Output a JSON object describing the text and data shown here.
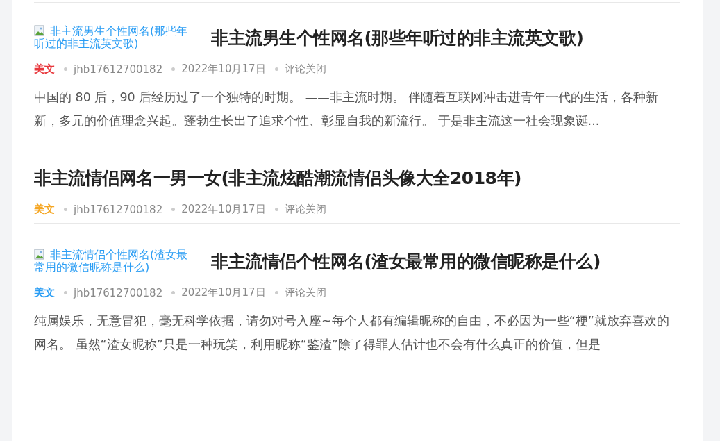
{
  "posts": [
    {
      "thumbnail": {
        "alt": "非主流男生个性网名(那些年听过的非主流英文歌)"
      },
      "title": "非主流男生个性网名(那些年听过的非主流英文歌)",
      "category": "美文",
      "color": "#e8383d",
      "author": "jhb17612700182",
      "date": "2022年10月17日",
      "comments": "评论关闭",
      "excerpt": "中国的 80 后，90 后经历过了一个独特的时期。 ——非主流时期。 伴随着互联网冲击进青年一代的生活，各种新新，多元的价值理念兴起。蓬勃生长出了追求个性、彰显自我的新流行。 于是非主流这一社会现象诞..."
    },
    {
      "title": "非主流情侣网名一男一女(非主流炫酷潮流情侣头像大全2018年)",
      "category": "美文",
      "color": "#f5a623",
      "author": "jhb17612700182",
      "date": "2022年10月17日",
      "comments": "评论关闭"
    },
    {
      "thumbnail": {
        "alt": "非主流情侣个性网名(渣女最常用的微信昵称是什么)"
      },
      "title": "非主流情侣个性网名(渣女最常用的微信昵称是什么)",
      "category": "美文",
      "color": "#2a9df4",
      "author": "jhb17612700182",
      "date": "2022年10月17日",
      "comments": "评论关闭",
      "excerpt": "纯属娱乐，无意冒犯，毫无科学依据，请勿对号入座~每个人都有编辑昵称的自由，不必因为一些“梗”就放弃喜欢的网名。 虽然“渣女昵称”只是一种玩笑，利用昵称“鉴渣”除了得罪人估计也不会有什么真正的价值，但是"
    }
  ]
}
